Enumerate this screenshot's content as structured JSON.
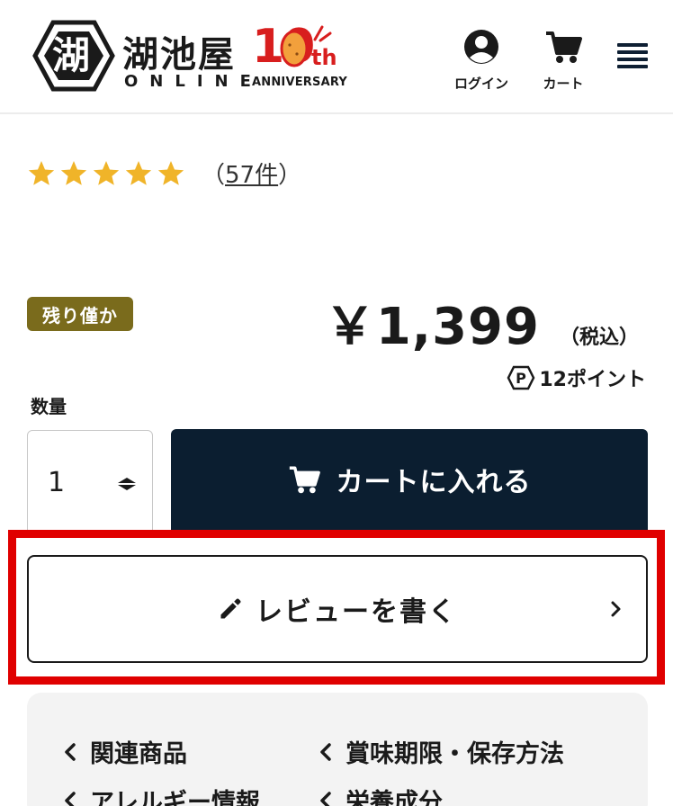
{
  "header": {
    "logo_mark": "湖",
    "logo_name": "湖池屋",
    "logo_sub": "ONLINE",
    "anniversary_number": "10",
    "anniversary_suffix": "th",
    "anniversary_text": "ANNIVERSARY",
    "login_label": "ログイン",
    "cart_label": "カート",
    "icons": {
      "login": "user-circle-icon",
      "cart": "cart-icon",
      "menu": "hamburger-menu-icon"
    }
  },
  "rating": {
    "stars": 5,
    "paren_open": "（",
    "count": "57件",
    "paren_close": "）",
    "star_color": "#f0b429"
  },
  "product": {
    "stock_badge": "残り僅か",
    "stock_badge_color": "#7a6b1c",
    "price": "￥1,399",
    "tax_label": "（税込）",
    "points_icon": "P",
    "points_text": "12ポイント"
  },
  "purchase": {
    "quantity_label": "数量",
    "quantity_value": "1",
    "add_to_cart_label": "カートに入れる",
    "button_color": "#0b1e30"
  },
  "review": {
    "write_review_label": "レビューを書く",
    "highlight_color": "#e00000"
  },
  "links": [
    {
      "label": "関連商品"
    },
    {
      "label": "賞味期限・保存方法"
    },
    {
      "label": "アレルギー情報"
    },
    {
      "label": "栄養成分"
    }
  ]
}
